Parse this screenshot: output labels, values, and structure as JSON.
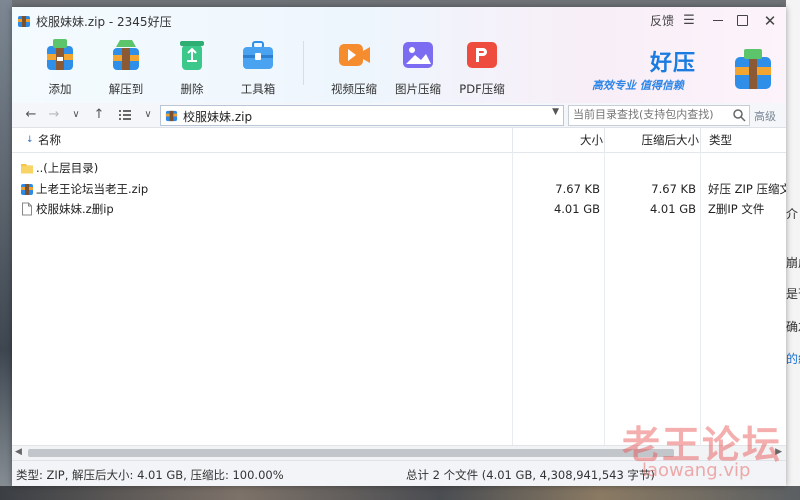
{
  "window": {
    "title": "校服妹妹.zip - 2345好压",
    "feedback": "反馈",
    "menu_glyph": "☰",
    "close_glyph": "✕"
  },
  "toolbar": {
    "items": [
      {
        "label": "添加",
        "icon": "add-archive-icon"
      },
      {
        "label": "解压到",
        "icon": "extract-to-icon"
      },
      {
        "label": "删除",
        "icon": "recycle-delete-icon"
      },
      {
        "label": "工具箱",
        "icon": "toolbox-icon"
      },
      {
        "label": "视频压缩",
        "icon": "video-compress-icon"
      },
      {
        "label": "图片压缩",
        "icon": "image-compress-icon"
      },
      {
        "label": "PDF压缩",
        "icon": "pdf-compress-icon"
      }
    ]
  },
  "brand": {
    "name": "好压",
    "slogan": "高效专业  值得信赖"
  },
  "navbar": {
    "path": "校服妹妹.zip",
    "search_placeholder": "当前目录查找(支持包内查找)",
    "advanced": "高级"
  },
  "columns": {
    "name": "名称",
    "size": "大小",
    "compressed": "压缩后大小",
    "type": "类型"
  },
  "files": [
    {
      "name": "..(上层目录)",
      "size": "",
      "compressed": "",
      "type": "",
      "icon": "folder-icon"
    },
    {
      "name": "上老王论坛当老王.zip",
      "size": "7.67 KB",
      "compressed": "7.67 KB",
      "type": "好压 ZIP 压缩文",
      "icon": "archive-icon"
    },
    {
      "name": "校服妹妹.z删ip",
      "size": "4.01 GB",
      "compressed": "4.01 GB",
      "type": "Z删IP 文件",
      "icon": "file-icon"
    }
  ],
  "status": {
    "left": "类型: ZIP, 解压后大小: 4.01 GB, 压缩比: 100.00%",
    "right": "总计 2 个文件 (4.01 GB, 4,308,941,543 字节)"
  },
  "background": {
    "right_stubs": [
      "介",
      "崩成",
      "是否",
      "确左",
      "的紀"
    ]
  },
  "watermark": {
    "big": "老王论坛",
    "small": "laowang.vip"
  },
  "colors": {
    "accent": "#1a7be0",
    "watermark": "#e74c4c"
  }
}
